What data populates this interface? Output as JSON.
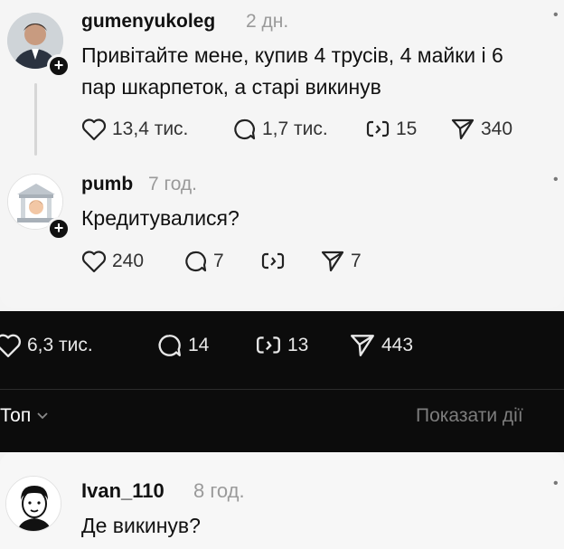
{
  "post1": {
    "username": "gumenyukoleg",
    "time": "2 дн.",
    "text_line1": "Привітайте мене, купив 4 трусів, 4 майки і 6",
    "text_line2": "пар шкарпеток, а старі викинув",
    "likes": "13,4 тис.",
    "comments": "1,7 тис.",
    "reposts": "15",
    "shares": "340"
  },
  "post2": {
    "username": "pumb",
    "time": "7 год.",
    "text": "Кредитувалися?",
    "likes": "240",
    "comments": "7",
    "reposts": "",
    "shares": "7"
  },
  "stats": {
    "likes": "6,3 тис.",
    "comments": "14",
    "reposts": "13",
    "shares": "443"
  },
  "sort": {
    "label": "Топ",
    "show_activity": "Показати дії"
  },
  "post3": {
    "username": "Ivan_110",
    "time": "8 год.",
    "text": "Де викинув?"
  },
  "colors": {
    "dark_bg": "#0c0c0c",
    "light_bg": "#f5f5f5",
    "muted": "#9a9a9a"
  }
}
